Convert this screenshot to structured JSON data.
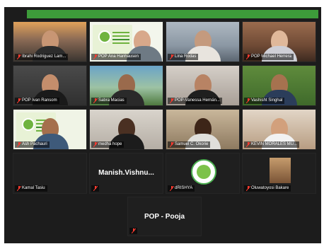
{
  "meeting": {
    "accent_color": "#3d9b3a",
    "participants": [
      {
        "name": "Ibrahi Rodriguez Lam...",
        "muted": true
      },
      {
        "name": "POP Ana Hanhausen",
        "muted": true
      },
      {
        "name": "Lina Rodas",
        "muted": true
      },
      {
        "name": "POP Michael Herrera",
        "muted": true
      },
      {
        "name": "POP Ivan Ransom",
        "muted": true
      },
      {
        "name": "Sabra Macias",
        "muted": true
      },
      {
        "name": "POP-Vanessa Hernán...",
        "muted": true
      },
      {
        "name": "Vashisht Singhal",
        "muted": true
      },
      {
        "name": "Ash Pachauri",
        "muted": true
      },
      {
        "name": "medha hope",
        "muted": true
      },
      {
        "name": "Samuel C. Okorie",
        "muted": true
      },
      {
        "name": "KEVIN MORALES MU...",
        "muted": true
      },
      {
        "name": "Kamal Tasiu",
        "muted": true
      },
      {
        "name": "",
        "display_text": "Manish.Vishnu...",
        "muted": true
      },
      {
        "name": "dRISHYA",
        "muted": true
      },
      {
        "name": "Oluwatoyosi Bakare",
        "muted": true
      },
      {
        "name": "",
        "display_text": "POP - Pooja",
        "muted": true
      }
    ]
  }
}
